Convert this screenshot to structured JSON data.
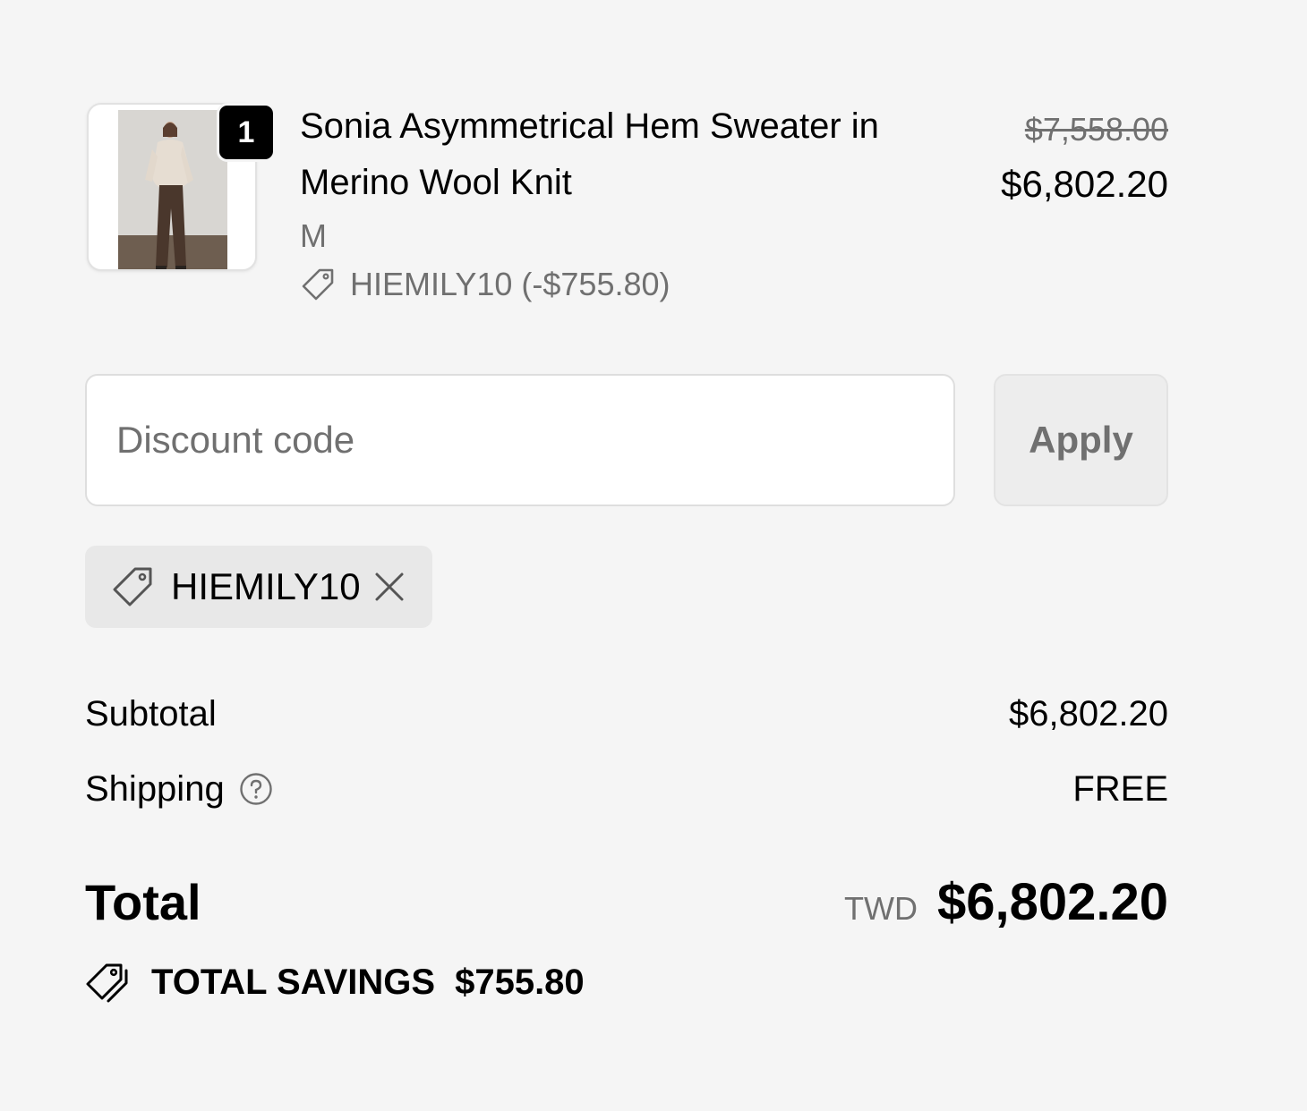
{
  "line_item": {
    "quantity": "1",
    "title": "Sonia Asymmetrical Hem Sweater in Merino Wool Knit",
    "variant": "M",
    "discount_allocation": "HIEMILY10 (-$755.80)",
    "compare_at_price": "$7,558.00",
    "price": "$6,802.20",
    "image_icon": "product-photo"
  },
  "discount_form": {
    "placeholder": "Discount code",
    "value": "",
    "apply_label": "Apply"
  },
  "applied_code": {
    "label": "HIEMILY10",
    "tag_icon": "tag-icon",
    "remove_icon": "close-icon"
  },
  "totals": {
    "subtotal_label": "Subtotal",
    "subtotal_value": "$6,802.20",
    "shipping_label": "Shipping",
    "shipping_value": "FREE",
    "shipping_help_icon": "question-circle-icon",
    "total_label": "Total",
    "currency": "TWD",
    "total_value": "$6,802.20",
    "savings_label": "TOTAL SAVINGS",
    "savings_value": "$755.80",
    "savings_icon": "tags-icon"
  },
  "colors": {
    "background": "#f5f5f5",
    "text_primary": "#000000",
    "text_secondary": "#707070",
    "chip_background": "#e8e8e8",
    "button_disabled_background": "#ededed"
  }
}
